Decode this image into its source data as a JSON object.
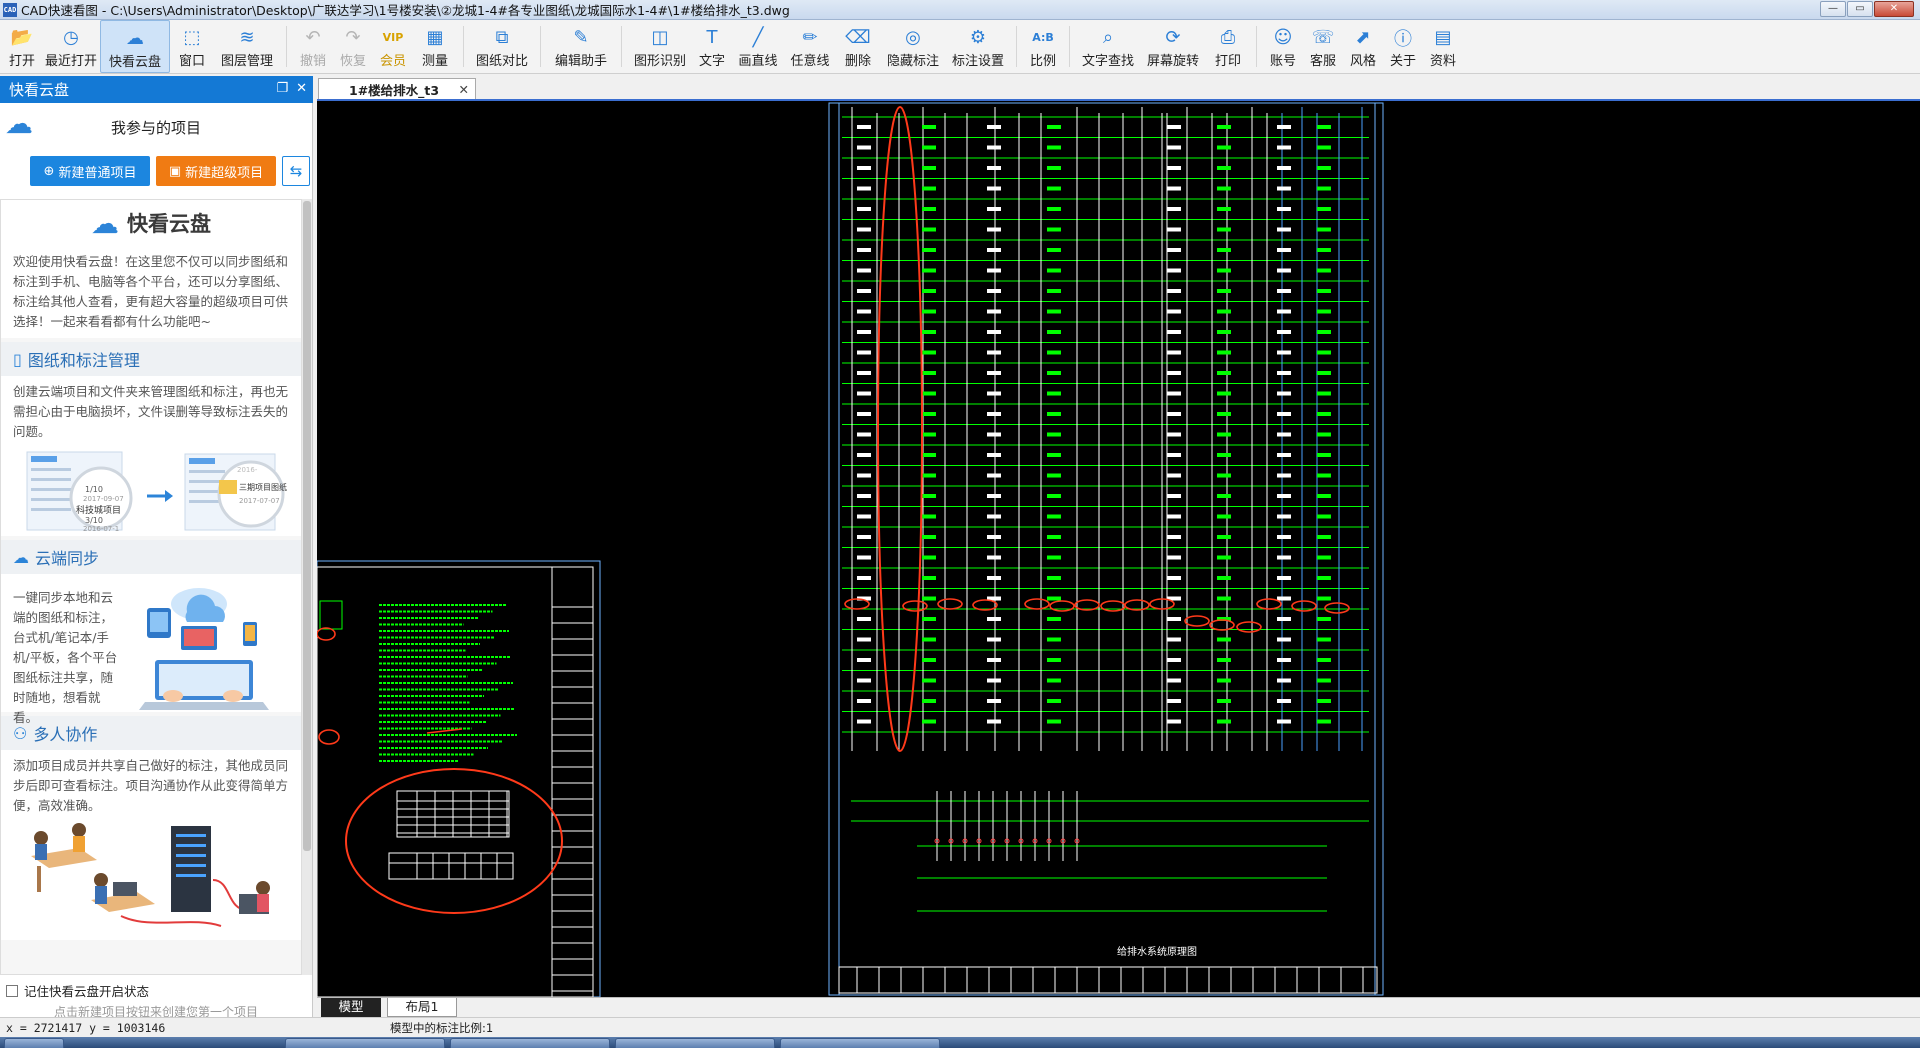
{
  "window": {
    "title": "CAD快速看图 - C:\\Users\\Administrator\\Desktop\\广联达学习\\1号楼安装\\②龙城1-4#各专业图纸\\龙城国际水1-4#\\1#楼给排水_t3.dwg",
    "app_logo_text": "CAD",
    "minimize_glyph": "—",
    "restore_glyph": "▭",
    "close_glyph": "✕"
  },
  "toolbar": {
    "items": [
      {
        "label": "打开",
        "icon": "open-folder-icon",
        "glyph": "📂",
        "state": "normal"
      },
      {
        "label": "最近打开",
        "icon": "recent-clock-icon",
        "glyph": "◷",
        "state": "normal"
      },
      {
        "label": "快看云盘",
        "icon": "cloud-icon",
        "glyph": "☁",
        "state": "active"
      },
      {
        "label": "窗口",
        "icon": "window-icon",
        "glyph": "⬚",
        "state": "normal"
      },
      {
        "label": "图层管理",
        "icon": "layers-icon",
        "glyph": "≋",
        "state": "normal"
      },
      {
        "label": "撤销",
        "icon": "undo-icon",
        "glyph": "↶",
        "state": "disabled"
      },
      {
        "label": "恢复",
        "icon": "redo-icon",
        "glyph": "↷",
        "state": "disabled"
      },
      {
        "label": "会员",
        "icon": "vip-icon",
        "glyph": "VIP",
        "state": "vip"
      },
      {
        "label": "测量",
        "icon": "measure-icon",
        "glyph": "▦",
        "state": "normal"
      },
      {
        "label": "图纸对比",
        "icon": "compare-icon",
        "glyph": "⧉",
        "state": "normal"
      },
      {
        "label": "编辑助手",
        "icon": "edit-assistant-icon",
        "glyph": "✎",
        "state": "normal"
      },
      {
        "label": "图形识别",
        "icon": "shape-recognition-icon",
        "glyph": "◫",
        "state": "normal"
      },
      {
        "label": "文字",
        "icon": "text-icon",
        "glyph": "T",
        "state": "normal"
      },
      {
        "label": "画直线",
        "icon": "line-icon",
        "glyph": "╱",
        "state": "normal"
      },
      {
        "label": "任意线",
        "icon": "freehand-icon",
        "glyph": "✏",
        "state": "normal"
      },
      {
        "label": "删除",
        "icon": "eraser-icon",
        "glyph": "⌫",
        "state": "normal"
      },
      {
        "label": "隐藏标注",
        "icon": "hide-annotation-icon",
        "glyph": "◎",
        "state": "normal"
      },
      {
        "label": "标注设置",
        "icon": "annotation-settings-icon",
        "glyph": "⚙",
        "state": "normal"
      },
      {
        "label": "比例",
        "icon": "scale-icon",
        "glyph": "A:B",
        "state": "normal"
      },
      {
        "label": "文字查找",
        "icon": "text-search-icon",
        "glyph": "⌕",
        "state": "normal"
      },
      {
        "label": "屏幕旋转",
        "icon": "rotate-screen-icon",
        "glyph": "⟳",
        "state": "normal"
      },
      {
        "label": "打印",
        "icon": "print-icon",
        "glyph": "⎙",
        "state": "normal"
      },
      {
        "label": "账号",
        "icon": "account-icon",
        "glyph": "☺",
        "state": "normal"
      },
      {
        "label": "客服",
        "icon": "headset-icon",
        "glyph": "☏",
        "state": "normal"
      },
      {
        "label": "风格",
        "icon": "style-icon",
        "glyph": "⬈",
        "state": "normal"
      },
      {
        "label": "关于",
        "icon": "info-icon",
        "glyph": "ⓘ",
        "state": "normal"
      },
      {
        "label": "资料",
        "icon": "resources-icon",
        "glyph": "▤",
        "state": "normal"
      }
    ]
  },
  "left_panel": {
    "title": "快看云盘",
    "restore_glyph": "❐",
    "close_glyph": "✕",
    "my_projects": "我参与的项目",
    "new_normal_project": "新建普通项目",
    "new_super_project": "新建超级项目",
    "sync_glyph": "⇆",
    "intro_title": "快看云盘",
    "intro_text": "欢迎使用快看云盘！在这里您不仅可以同步图纸和标注到手机、电脑等各个平台，还可以分享图纸、标注给其他人查看，更有超大容量的超级项目可供选择！一起来看看都有什么功能吧~",
    "sections": [
      {
        "title": "图纸和标注管理",
        "icon": "document-icon",
        "glyph": "▯",
        "text": "创建云端项目和文件夹来管理图纸和标注，再也无需担心由于电脑损坏，文件误删等导致标注丢失的问题。"
      },
      {
        "title": "云端同步",
        "icon": "cloud-sync-icon",
        "glyph": "☁",
        "text": "一键同步本地和云端的图纸和标注，台式机/笔记本/手机/平板，各个平台图纸标注共享，随时随地，想看就看。"
      },
      {
        "title": "多人协作",
        "icon": "people-icon",
        "glyph": "⚇",
        "text": "添加项目成员并共享自己做好的标注，其他成员同步后即可查看标注。项目沟通协作从此变得简单方便，高效准确。"
      }
    ],
    "illus_card": {
      "a_line1": "1/10",
      "a_line2": "2017-09-07",
      "b_label": "科技城项目",
      "b_line1": "3/10",
      "b_line2": "2016-07-1",
      "c_label": "三期项目图纸",
      "c_date1": "2016-",
      "c_date2": "2017-07-07"
    },
    "remember_label": "记住快看云盘开启状态",
    "hint": "点击新建项目按钮来创建您第一个项目"
  },
  "document_tab": {
    "label": "1#楼给排水_t3",
    "close": "✕"
  },
  "layout_tabs": [
    "模型",
    "布局1"
  ],
  "status_bar": {
    "coords": "x = 2721417  y = 1003146",
    "scale_text": "模型中的标注比例:1"
  },
  "colors": {
    "accent": "#1479d5",
    "orange": "#f07b13",
    "canvas_bg": "#000000",
    "cad_green": "#00ff00",
    "cad_white": "#ffffff",
    "markup_red": "#ff3a1a",
    "frame_cyan": "#6fb4ff"
  },
  "drawing": {
    "system_title": "给排水系统原理图"
  }
}
